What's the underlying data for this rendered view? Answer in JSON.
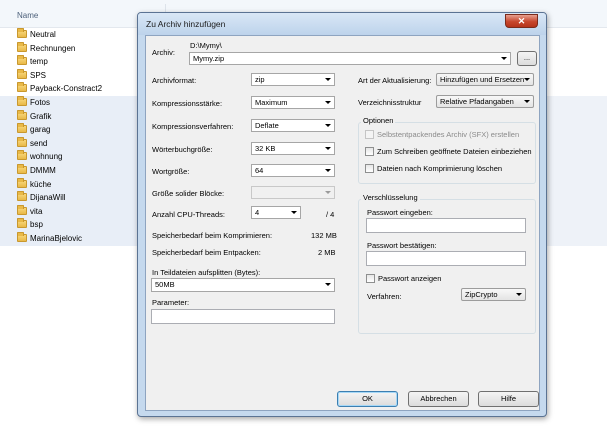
{
  "explorer": {
    "column_name": "Name",
    "files": [
      {
        "name": "Neutral",
        "selected": false
      },
      {
        "name": "Rechnungen",
        "selected": false
      },
      {
        "name": "temp",
        "selected": false
      },
      {
        "name": "SPS",
        "selected": false
      },
      {
        "name": "Payback-Constract2",
        "selected": false
      },
      {
        "name": "Fotos",
        "selected": true
      },
      {
        "name": "Grafik",
        "selected": true
      },
      {
        "name": "garag",
        "selected": true
      },
      {
        "name": "send",
        "selected": true
      },
      {
        "name": "wohnung",
        "selected": true
      },
      {
        "name": "DMMM",
        "selected": true
      },
      {
        "name": "küche",
        "selected": true
      },
      {
        "name": "DijanaWill",
        "selected": true
      },
      {
        "name": "vita",
        "selected": true
      },
      {
        "name": "bsp",
        "selected": true
      },
      {
        "name": "MarinaBjelovic",
        "selected": true
      }
    ]
  },
  "dialog": {
    "title": "Zu Archiv hinzufügen",
    "close_glyph": "✕",
    "archive_label": "Archiv:",
    "archive_path": "D:\\Mymy\\",
    "archive_name": "Mymy.zip",
    "browse_label": "...",
    "left": {
      "format_label": "Archivformat:",
      "format_value": "zip",
      "level_label": "Kompressionsstärke:",
      "level_value": "Maximum",
      "method_label": "Kompressionsverfahren:",
      "method_value": "Deflate",
      "dict_label": "Wörterbuchgröße:",
      "dict_value": "32 KB",
      "word_label": "Wortgröße:",
      "word_value": "64",
      "solid_label": "Größe solider Blöcke:",
      "solid_value": "",
      "threads_label": "Anzahl CPU-Threads:",
      "threads_value": "4",
      "threads_total": "/ 4",
      "mem_comp_label": "Speicherbedarf beim Komprimieren:",
      "mem_comp_value": "132 MB",
      "mem_decomp_label": "Speicherbedarf beim Entpacken:",
      "mem_decomp_value": "2 MB",
      "split_label": "In Teildateien aufsplitten (Bytes):",
      "split_value": "50MB",
      "params_label": "Parameter:",
      "params_value": ""
    },
    "right": {
      "update_label": "Art der Aktualisierung:",
      "update_value": "Hinzufügen und Ersetzen",
      "paths_label": "Verzeichnisstruktur",
      "paths_value": "Relative Pfadangaben",
      "options_title": "Optionen",
      "opt_sfx": "Selbstentpackendes Archiv (SFX) erstellen",
      "opt_shared": "Zum Schreiben geöffnete Dateien einbeziehen",
      "opt_delete": "Dateien nach Komprimierung löschen",
      "enc_title": "Verschlüsselung",
      "pw_label": "Passwort eingeben:",
      "pw_confirm_label": "Passwort bestätigen:",
      "show_pw_label": "Passwort anzeigen",
      "method_label": "Verfahren:",
      "method_value": "ZipCrypto"
    },
    "buttons": {
      "ok": "OK",
      "cancel": "Abbrechen",
      "help": "Hilfe"
    }
  }
}
